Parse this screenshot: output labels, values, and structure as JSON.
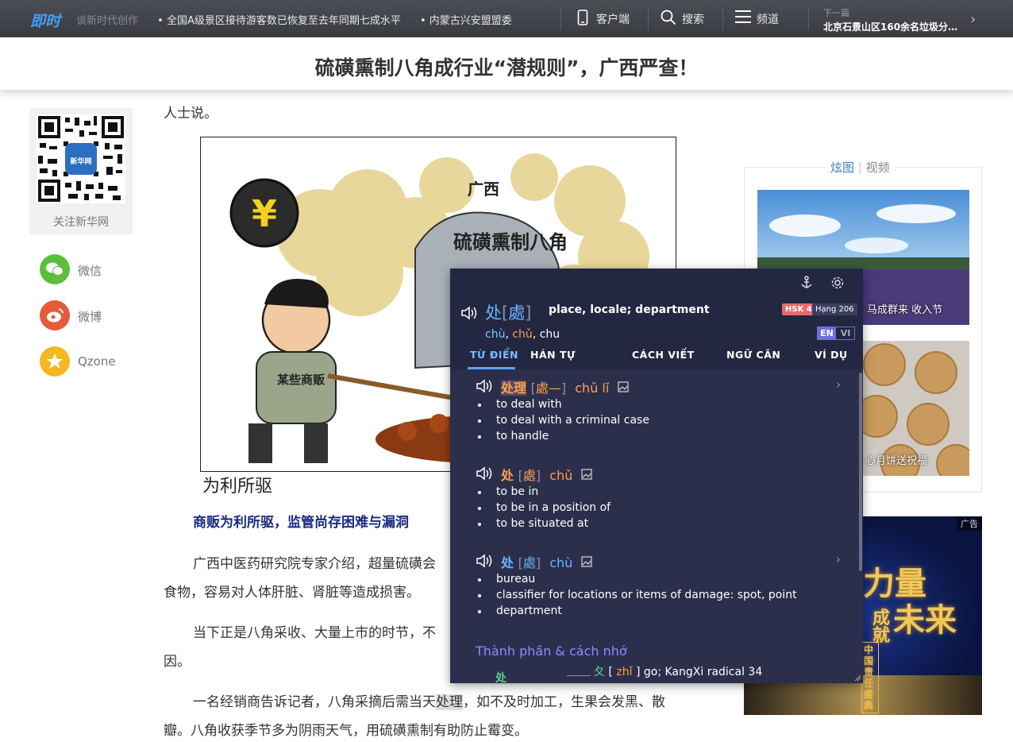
{
  "topbar": {
    "logo": "即时",
    "ticker": [
      "谈新时代创作",
      "• 全国A级景区接待游客数已恢复至去年同期七成水平",
      "• 内蒙古兴安盟盟委"
    ],
    "client_label": "客户端",
    "search_label": "搜索",
    "channel_label": "频道",
    "next_label": "下一篇",
    "next_title": "北京石景山区160余名垃圾分类..."
  },
  "headline": "硫磺熏制八角成行业“潜规则”，广西严查！",
  "left": {
    "qr_label": "关注新华网",
    "qr_badge": "新华网",
    "share": [
      {
        "label": "微信",
        "color": "#5bbf3b"
      },
      {
        "label": "微博",
        "color": "#e85a3c"
      },
      {
        "label": "Qzone",
        "color": "#f6b820"
      }
    ]
  },
  "article": {
    "first_line": "人士说。",
    "cartoon_texts": {
      "yen": "¥",
      "region": "广西",
      "sign": "硫磺熏制八角",
      "shirt": "某些商贩"
    },
    "caption": "为利所驱",
    "subhead": "商贩为利所驱，监管尚存困难与漏洞",
    "p1a": "广西中医药研究院专家介绍，超量硫磺会",
    "p1b": "食物，容易对人体肝脏、肾脏等造成损害。",
    "p2a": "当下正是八角采收、大量上市的时节，不",
    "p2b": "因。",
    "p3a_pre": "一名经销商告诉记者，八角采摘后需当天",
    "p3a_hl": "处理",
    "p3a_post": "，如不及时加工，生果会发黑、散",
    "p3b": "瓣。八角收获季节多为阴雨天气，用硫磺熏制有助防止霉变。"
  },
  "right": {
    "tab_active": "炫图",
    "tab_other": "视频",
    "photo1_caption": "马成群来 收入节",
    "photo2_caption": "心月饼送祝福",
    "ad_tag": "广告",
    "ad_line1": "力量",
    "ad_line2": "成",
    "ad_line3": "未来",
    "ad_line4": "就",
    "ad_small": "中国责任盛典"
  },
  "popup": {
    "headword": "处",
    "traditional": "處",
    "gloss": "place, locale; department",
    "pinyin": [
      "chù",
      "chǔ",
      "chu"
    ],
    "hsk": "HSK 4",
    "rank": "Hạng 206",
    "lang_en": "EN",
    "lang_vi": "VI",
    "tabs": [
      "TỪ ĐIỂN",
      "HÁN TỰ",
      "CÁCH VIẾT",
      "NGỮ CĂN",
      "VÍ DỤ"
    ],
    "entries": [
      {
        "word": "处理",
        "trad": "處—",
        "pinyin": "chǔ lǐ",
        "defs": [
          "to deal with",
          "to deal with a criminal case",
          "to handle"
        ]
      },
      {
        "word": "处",
        "trad": "處",
        "pinyin": "chǔ",
        "defs": [
          "to be in",
          "to be in a position of",
          "to be situated at"
        ]
      },
      {
        "word": "处",
        "trad": "處",
        "pinyin": "chù",
        "defs": [
          "bureau",
          "classifier for locations or items of damage: spot, point",
          "department"
        ]
      }
    ],
    "components_title": "Thành phần & cách nhớ",
    "component_char": "处",
    "component_part": "夂",
    "component_pinyin": "zhǐ",
    "component_desc": "go; KangXi radical 34"
  },
  "colors": {
    "accent": "#6ab4ff",
    "orange": "#ffa04a",
    "popup_bg": "#2b2f4c"
  }
}
